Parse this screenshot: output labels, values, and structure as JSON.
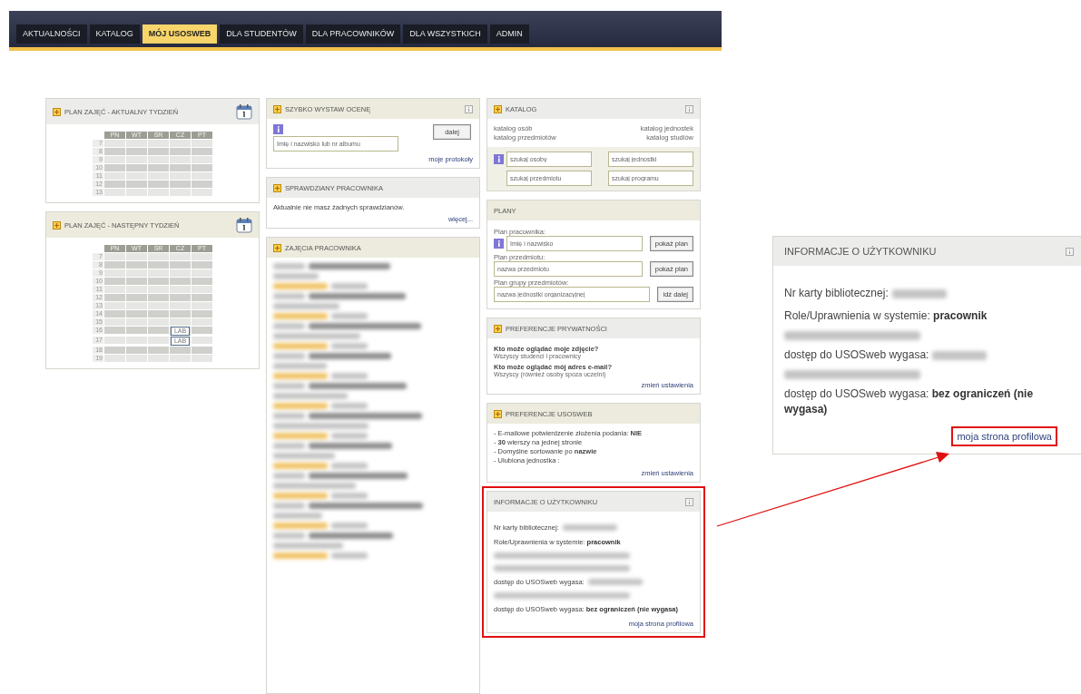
{
  "nav": {
    "tabs": [
      {
        "label": "AKTUALNOŚCI",
        "selected": false
      },
      {
        "label": "KATALOG",
        "selected": false
      },
      {
        "label": "MÓJ USOSWEB",
        "selected": true
      },
      {
        "label": "DLA STUDENTÓW",
        "selected": false
      },
      {
        "label": "DLA PRACOWNIKÓW",
        "selected": false
      },
      {
        "label": "DLA WSZYSTKICH",
        "selected": false
      },
      {
        "label": "ADMIN",
        "selected": false
      }
    ]
  },
  "columns": [
    [
      {
        "kind": "timetable",
        "title": "PLAN ZAJĘĆ - AKTUALNY TYDZIEŃ",
        "expandable": true,
        "days": [
          "PN",
          "WT",
          "ŚR",
          "CZ",
          "PT"
        ],
        "rows": [
          {
            "hour": "7",
            "cells": [
              null,
              null,
              null,
              null,
              null
            ]
          },
          {
            "hour": "8",
            "cells": [
              null,
              null,
              null,
              null,
              null
            ]
          },
          {
            "hour": "9",
            "cells": [
              null,
              null,
              null,
              null,
              null
            ]
          },
          {
            "hour": "10",
            "cells": [
              null,
              null,
              null,
              null,
              null
            ]
          },
          {
            "hour": "11",
            "cells": [
              null,
              null,
              null,
              null,
              null
            ]
          },
          {
            "hour": "12",
            "cells": [
              null,
              null,
              null,
              null,
              null
            ]
          },
          {
            "hour": "13",
            "cells": [
              null,
              null,
              null,
              null,
              null
            ]
          }
        ]
      },
      {
        "kind": "timetable",
        "title": "PLAN ZAJĘĆ - NASTĘPNY TYDZIEŃ",
        "expandable": true,
        "days": [
          "PN",
          "WT",
          "ŚR",
          "CZ",
          "PT"
        ],
        "rows": [
          {
            "hour": "7",
            "cells": [
              null,
              null,
              null,
              null,
              null
            ]
          },
          {
            "hour": "8",
            "cells": [
              null,
              null,
              null,
              null,
              null
            ]
          },
          {
            "hour": "9",
            "cells": [
              null,
              null,
              null,
              null,
              null
            ]
          },
          {
            "hour": "10",
            "cells": [
              null,
              null,
              null,
              null,
              null
            ]
          },
          {
            "hour": "11",
            "cells": [
              null,
              null,
              null,
              null,
              null
            ]
          },
          {
            "hour": "12",
            "cells": [
              null,
              null,
              null,
              null,
              null
            ]
          },
          {
            "hour": "13",
            "cells": [
              null,
              null,
              null,
              null,
              null
            ]
          },
          {
            "hour": "14",
            "cells": [
              null,
              null,
              null,
              null,
              null
            ]
          },
          {
            "hour": "15",
            "cells": [
              null,
              null,
              null,
              null,
              null
            ]
          },
          {
            "hour": "16",
            "cells": [
              null,
              null,
              null,
              {
                "label": "LAB"
              },
              null
            ]
          },
          {
            "hour": "17",
            "cells": [
              null,
              null,
              null,
              {
                "label": "LAB"
              },
              null
            ]
          },
          {
            "hour": "18",
            "cells": [
              null,
              null,
              null,
              null,
              null
            ]
          },
          {
            "hour": "19",
            "cells": [
              null,
              null,
              null,
              null,
              null
            ]
          }
        ]
      }
    ],
    [
      {
        "kind": "grade",
        "title": "SZYBKO WYSTAW OCENĘ",
        "expandable": true,
        "help": true,
        "placeholder": "Imię i nazwisko lub nr albumu",
        "button": "dalej",
        "link": "moje protokoły"
      },
      {
        "kind": "tests",
        "title": "SPRAWDZIANY PRACOWNIKA",
        "expandable": true,
        "text": "Aktualnie nie masz żadnych sprawdzianów.",
        "link": "więcej..."
      },
      {
        "kind": "classes",
        "title": "ZAJĘCIA PRACOWNIKA",
        "expandable": true
      }
    ],
    [
      {
        "kind": "catalog",
        "title": "KATALOG",
        "expandable": true,
        "help": true,
        "links": [
          "katalog osób",
          "katalog jednostek",
          "katalog przedmiotów",
          "katalog studiów"
        ],
        "placeholders": [
          "szukaj osoby",
          "szukaj jednostki",
          "szukaj przedmiotu",
          "szukaj programu"
        ]
      },
      {
        "kind": "plans",
        "title": "PLANY",
        "expandable": false,
        "groups": [
          {
            "label": "Plan pracownika:",
            "placeholder": "Imię i nazwisko",
            "button": "pokaż plan",
            "info": true
          },
          {
            "label": "Plan przedmiotu:",
            "placeholder": "nazwa przedmiotu",
            "button": "pokaż plan",
            "info": false
          },
          {
            "label": "Plan grupy przedmiotów:",
            "placeholder": "nazwa jednostki organizacyjnej",
            "button": "idź dalej",
            "info": false
          }
        ]
      },
      {
        "kind": "privacy",
        "title": "PREFERENCJE PRYWATNOŚCI",
        "expandable": true,
        "items": [
          {
            "question": "Kto może oglądać moje zdjęcie?",
            "answer": "Wszyscy studenci i pracownicy"
          },
          {
            "question": "Kto może oglądać mój adres e-mail?",
            "answer": "Wszyscy (również osoby spoza uczelni)"
          }
        ],
        "link": "zmień ustawienia"
      },
      {
        "kind": "prefs",
        "title": "PREFERENCJE USOSWEB",
        "expandable": true,
        "lines": [
          "- E-mailowe potwierdzenie złożenia podania: **NIE**",
          "- **30** wierszy na jednej stronie",
          "- Domyślne sortowanie po **nazwie**",
          "- Ulubiona jednostka :"
        ],
        "link": "zmień ustawienia"
      },
      {
        "kind": "userinfo",
        "title": "INFORMACJE O UŻYTKOWNIKU",
        "expandable": false,
        "help": true,
        "highlighted": true,
        "lines": [
          {
            "kind": "text",
            "text": "Nr karty bibliotecznej:",
            "redacted_value": true
          },
          {
            "kind": "text",
            "text": "Role/Uprawnienia w systemie: **pracownik**",
            "redacted_value": false
          },
          {
            "kind": "redacted"
          },
          {
            "kind": "redacted"
          },
          {
            "kind": "text",
            "text": "dostęp do USOSweb wygasa:",
            "redacted_value": true
          },
          {
            "kind": "redacted"
          },
          {
            "kind": "text",
            "text": "dostęp do USOSweb wygasa: **bez ograniczeń (nie wygasa)**",
            "redacted_value": false
          }
        ],
        "link": "moja strona profilowa"
      }
    ]
  ],
  "callout": {
    "title": "INFORMACJE O UŻYTKOWNIKU",
    "help": true,
    "lines": [
      {
        "kind": "text",
        "text": "Nr karty bibliotecznej:",
        "redacted_value": true
      },
      {
        "kind": "text",
        "text": "Role/Uprawnienia w systemie: **pracownik**",
        "redacted_value": false
      },
      {
        "kind": "redacted"
      },
      {
        "kind": "text",
        "text": "dostęp do USOSweb wygasa:",
        "redacted_value": true
      },
      {
        "kind": "redacted"
      },
      {
        "kind": "text",
        "text": "dostęp do USOSweb wygasa: **bez ograniczeń (nie wygasa)**",
        "redacted_value": false
      }
    ],
    "link": "moja strona profilowa",
    "link_highlighted": true
  }
}
